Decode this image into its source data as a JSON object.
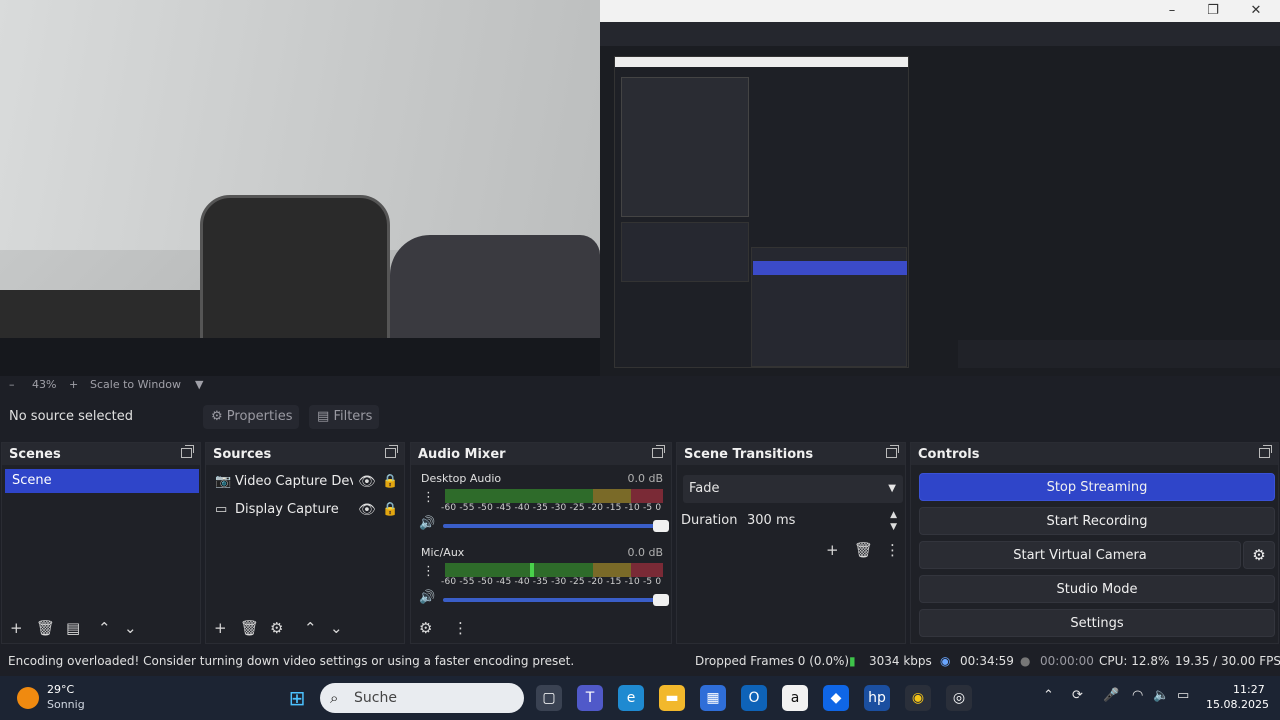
{
  "preview": {
    "zoom": "43%",
    "scale_mode": "Scale to Window"
  },
  "source_toolbar": {
    "no_source": "No source selected",
    "properties_label": "Properties",
    "filters_label": "Filters"
  },
  "scenes": {
    "title": "Scenes",
    "items": [
      "Scene"
    ]
  },
  "sources": {
    "title": "Sources",
    "items": [
      {
        "name": "Video Capture Device",
        "icon": "camera-icon"
      },
      {
        "name": "Display Capture",
        "icon": "monitor-icon"
      }
    ]
  },
  "mixer": {
    "title": "Audio Mixer",
    "scale": "-60 -55 -50 -45 -40 -35 -30 -25 -20 -15 -10 -5 0",
    "channels": [
      {
        "name": "Desktop Audio",
        "db": "0.0 dB",
        "level": 0.0,
        "volume": 1.0
      },
      {
        "name": "Mic/Aux",
        "db": "0.0 dB",
        "level": 0.39,
        "volume": 1.0
      }
    ]
  },
  "transitions": {
    "title": "Scene Transitions",
    "selected": "Fade",
    "duration_label": "Duration",
    "duration_value": "300 ms"
  },
  "controls": {
    "title": "Controls",
    "stop_streaming": "Stop Streaming",
    "start_recording": "Start Recording",
    "start_virtual_camera": "Start Virtual Camera",
    "studio_mode": "Studio Mode",
    "settings": "Settings"
  },
  "status": {
    "message": "Encoding overloaded! Consider turning down video settings or using a faster encoding preset.",
    "dropped_frames": "Dropped Frames 0 (0.0%)",
    "bitrate": "3034 kbps",
    "stream_time": "00:34:59",
    "record_time": "00:00:00",
    "cpu": "CPU: 12.8%",
    "fps": "19.35 / 30.00 FPS"
  },
  "taskbar": {
    "weather_temp": "29°C",
    "weather_desc": "Sonnig",
    "search_placeholder": "Suche",
    "time": "11:27",
    "date": "15.08.2025"
  },
  "colors": {
    "accent": "#2f45c9",
    "background": "#1d1f26",
    "dock": "#1f2127"
  }
}
